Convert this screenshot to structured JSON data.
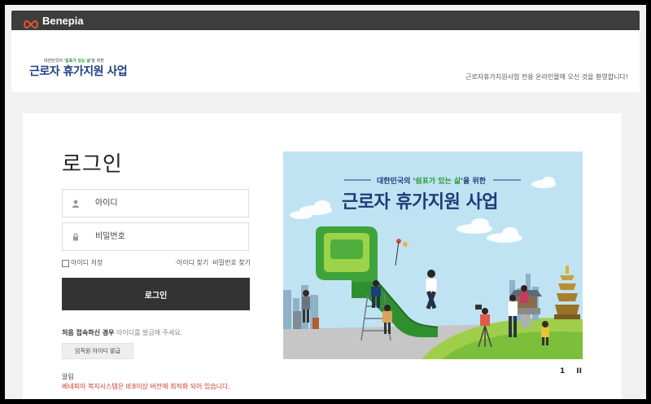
{
  "site": {
    "name": "Benepia"
  },
  "header": {
    "brand_small_prefix": "대한민국의 '",
    "brand_small_highlight": "쉼표가 있는 삶",
    "brand_small_suffix": "'을 위한",
    "brand_title": "근로자 휴가지원 사업",
    "welcome": "근로자휴가지원사업 전용 온라인몰에 오신 것을 환영합니다!"
  },
  "login": {
    "title": "로그인",
    "id_placeholder": "아이디",
    "pw_placeholder": "비밀번호",
    "remember_label": "아이디 저장",
    "find_id": "아이디 찾기",
    "find_pw": "비밀번호 찾기",
    "submit_label": "로그인",
    "first_visit_bold": "처음 접속하신 경우",
    "first_visit_text": " 아이디를 발급해 주세요.",
    "issue_button": "임직원 아이디 발급",
    "notice_label": "알림",
    "notice_text": "베네피아 복지시스템은 IE8이상 버전에 최적화 되어 있습니다."
  },
  "banner": {
    "small_prefix": "대한민국의 '",
    "small_highlight": "쉼표가 있는 삶",
    "small_suffix": "'을 위한",
    "title": "근로자 휴가지원 사업",
    "page": "1",
    "pause": "II"
  },
  "colors": {
    "topbar": "#3d3d3d",
    "brand_blue": "#1e3f82",
    "brand_green": "#2b9b3a",
    "button_dark": "#333333",
    "notice_red": "#d23a2a",
    "logo_orange": "#e8542c"
  },
  "icons": {
    "logo": "benepia-infinity-logo",
    "id_field": "user-icon",
    "pw_field": "lock-icon"
  }
}
